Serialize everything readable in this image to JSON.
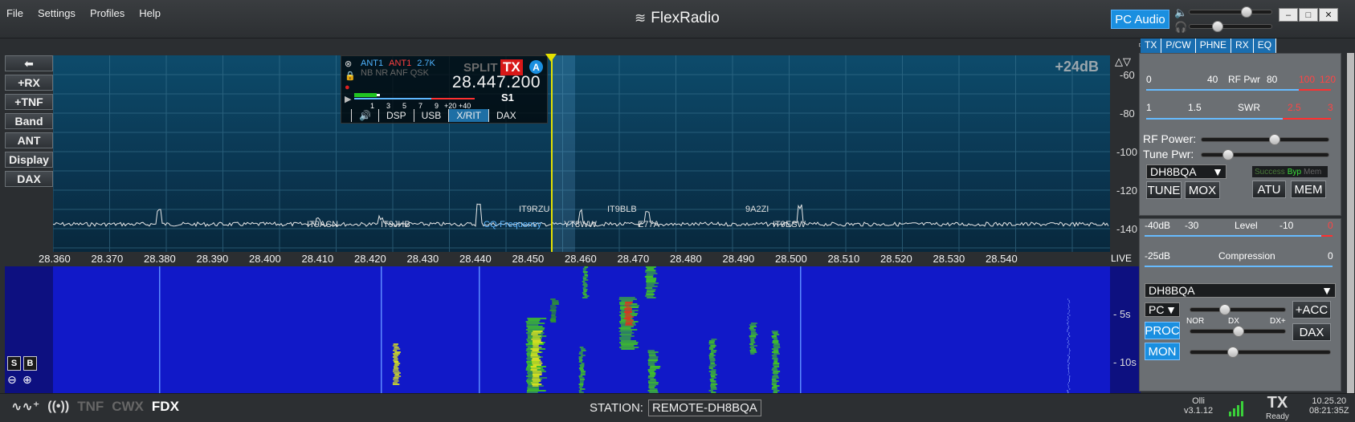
{
  "menu": [
    "File",
    "Settings",
    "Profiles",
    "Help"
  ],
  "brand": "FlexRadio",
  "pc_audio_label": "PC Audio",
  "window_buttons": [
    "–",
    "□",
    "✕"
  ],
  "left_tools": [
    "+RX",
    "+TNF",
    "Band",
    "ANT",
    "Display",
    "DAX"
  ],
  "db_label": "+24dB",
  "db_scale": [
    "-60",
    "-80",
    "-100",
    "-120",
    "-140"
  ],
  "flag": {
    "ant_rx": "ANT1",
    "ant_tx": "ANT1",
    "bw": "2.7K",
    "dsp_flags": "NB NR ANF QSK",
    "split": "SPLIT",
    "tx": "TX",
    "slice": "A",
    "frequency": "28.447.200",
    "s_label": "S1",
    "meter_ticks": [
      "1",
      "3",
      "5",
      "7",
      "9",
      "+20",
      "+40"
    ],
    "tabs": [
      "🔊",
      "DSP",
      "USB",
      "X/RIT",
      "DAX"
    ]
  },
  "spots": [
    {
      "call": "IT9RZU",
      "row": 0
    },
    {
      "call": "IT9BLB",
      "row": 0
    },
    {
      "call": "9A2ZI",
      "row": 0
    },
    {
      "call": "IT9ACN",
      "row": 1
    },
    {
      "call": "IT9JHB",
      "row": 1
    },
    {
      "call": "CQ-Frequency",
      "row": 1
    },
    {
      "call": "YT8WW",
      "row": 1
    },
    {
      "call": "E77A",
      "row": 1
    },
    {
      "call": "IT9ESW",
      "row": 1
    }
  ],
  "freq_scale": [
    "28.360",
    "28.370",
    "28.380",
    "28.390",
    "28.400",
    "28.410",
    "28.420",
    "28.430",
    "28.440",
    "28.450",
    "28.460",
    "28.470",
    "28.480",
    "28.490",
    "28.500",
    "28.510",
    "28.520",
    "28.530",
    "28.540"
  ],
  "live_label": "LIVE",
  "wf_times": [
    "5s",
    "10s"
  ],
  "wf_buttons": [
    "S",
    "B"
  ],
  "status": {
    "tnf": "TNF",
    "cwx": "CWX",
    "fdx": "FDX",
    "station_label": "STATION:",
    "station_name": "REMOTE-DH8BQA",
    "user": "Olli",
    "version": "v3.1.12",
    "tx": "TX",
    "tx_state": "Ready",
    "date": "10.25.20",
    "time": "08:21:35Z"
  },
  "right_panel": {
    "tabs": [
      "TX",
      "P/CW",
      "PHNE",
      "RX",
      "EQ"
    ],
    "rfpwr_scale": [
      "0",
      "40",
      "RF Pwr",
      "80",
      "100",
      "120"
    ],
    "swr_scale": [
      "1",
      "1.5",
      "SWR",
      "2.5",
      "3"
    ],
    "rf_power_label": "RF Power:",
    "tune_pwr_label": "Tune Pwr:",
    "profile": "DH8BQA",
    "atu_status": [
      "Success",
      "Byp",
      "Mem"
    ],
    "buttons_tx": [
      "TUNE",
      "MOX",
      "ATU",
      "MEM"
    ],
    "level_scale": [
      "-40dB",
      "-30",
      "Level",
      "-10",
      "0"
    ],
    "comp_scale": [
      "-25dB",
      "Compression",
      "0"
    ],
    "mic_profile": "DH8BQA",
    "mic_source": "PC",
    "acc": "+ACC",
    "proc": "PROC",
    "proc_labels": [
      "NOR",
      "DX",
      "DX+"
    ],
    "dax": "DAX",
    "mon": "MON"
  },
  "colors": {
    "accent_blue": "#1a8fe0",
    "tx_red": "#d81818",
    "waterfall": "#1119c8"
  }
}
